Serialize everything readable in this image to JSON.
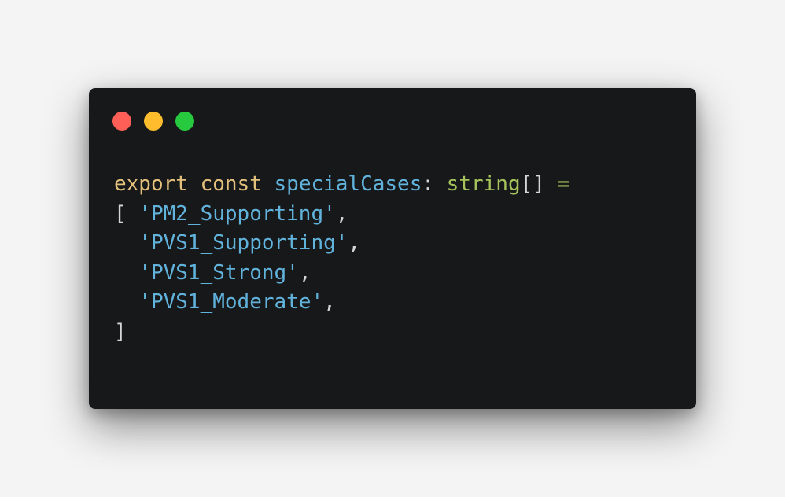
{
  "colors": {
    "page_bg": "#f4f4f4",
    "window_bg": "#17181a",
    "red": "#ff5f56",
    "yellow": "#ffbd2e",
    "green": "#27c93f",
    "keyword": "#e3c07b",
    "identifier": "#61b3dc",
    "type": "#a6c35c",
    "operator": "#a6c35c",
    "string": "#61b3dc",
    "punctuation": "#d6d6d6"
  },
  "window_controls": {
    "close": "close-dot",
    "minimize": "minimize-dot",
    "maximize": "maximize-dot"
  },
  "code": {
    "line1": {
      "kw_export": "export",
      "kw_const": "const",
      "identifier": "specialCases",
      "colon": ":",
      "type": "string",
      "brackets": "[]",
      "equals": "="
    },
    "line2": {
      "open": "[",
      "value": "'PM2_Supporting'",
      "comma": ","
    },
    "line3": {
      "value": "'PVS1_Supporting'",
      "comma": ","
    },
    "line4": {
      "value": "'PVS1_Strong'",
      "comma": ","
    },
    "line5": {
      "value": "'PVS1_Moderate'",
      "comma": ","
    },
    "line6": {
      "close": "]"
    }
  }
}
